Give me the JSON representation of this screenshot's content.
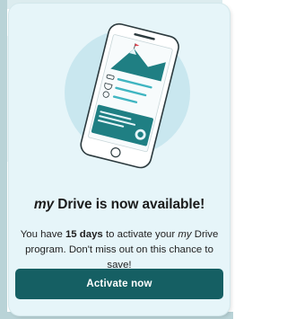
{
  "promo": {
    "title_brand": "my",
    "title_rest": " Drive is now available!",
    "desc_part1": "You have ",
    "desc_days": "15 days",
    "desc_part2": " to activate your ",
    "desc_brand": "my",
    "desc_part3": " Drive program. Don't miss out on this chance to save!",
    "cta_label": "Activate now"
  },
  "colors": {
    "card_bg": "#e6f5f9",
    "button_bg": "#155f63",
    "accent_teal": "#1f7f83",
    "accent_red": "#e0424f"
  },
  "icons": [
    "phone-illustration-icon",
    "mountain-icon",
    "flag-icon",
    "car-icon",
    "trophy-icon",
    "badge-icon"
  ]
}
